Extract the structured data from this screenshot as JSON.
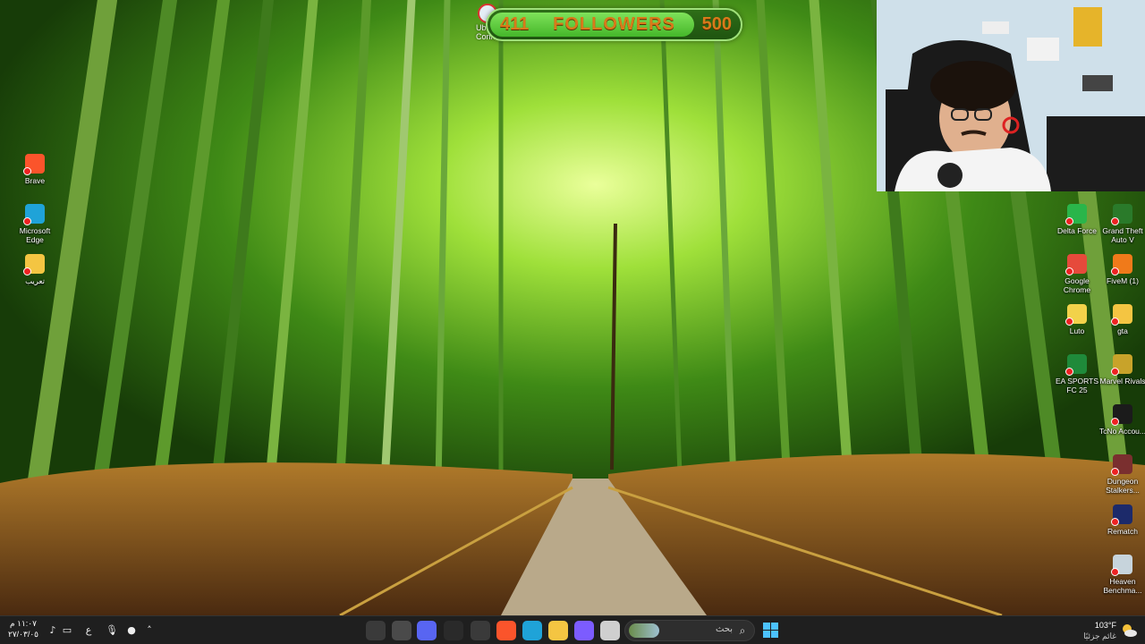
{
  "overlay": {
    "followers_current": "411",
    "followers_label": "FOLLOWERS",
    "followers_goal": "500",
    "progress_fraction": 0.822,
    "stream_icon_label": "Ub\nConn"
  },
  "desktop_left": [
    {
      "label": "Brave",
      "icon": "brave-icon",
      "color": "#fb542b"
    },
    {
      "label": "Microsoft Edge",
      "icon": "edge-icon",
      "color": "#1fa3d8"
    },
    {
      "label": "تعريب",
      "icon": "folder-icon",
      "color": "#f4c542"
    }
  ],
  "desktop_right": [
    {
      "label": "Delta Force",
      "icon": "delta-force-icon",
      "color": "#2ab54a"
    },
    {
      "label": "Grand Theft Auto V",
      "icon": "gta-v-icon",
      "color": "#2a7a2a"
    },
    {
      "label": "Google Chrome",
      "icon": "chrome-icon",
      "color": "#e64a3b"
    },
    {
      "label": "FiveM (1)",
      "icon": "fivem-icon",
      "color": "#f07a1a"
    },
    {
      "label": "Luto",
      "icon": "luto-icon",
      "color": "#f2d24a"
    },
    {
      "label": "gta",
      "icon": "folder-icon",
      "color": "#f4c542"
    },
    {
      "label": "EA SPORTS FC 25",
      "icon": "ea-fc-icon",
      "color": "#1f8a3a"
    },
    {
      "label": "Marvel Rivals",
      "icon": "marvel-rivals-icon",
      "color": "#c8a32a"
    },
    {
      "label": "TcNo Accou...",
      "icon": "tcno-icon",
      "color": "#1b1b1b"
    },
    {
      "label": "Dungeon Stalkers...",
      "icon": "dungeon-stalkers-icon",
      "color": "#7a2f2f"
    },
    {
      "label": "Rematch",
      "icon": "rematch-icon",
      "color": "#1c2a6a"
    },
    {
      "label": "Heaven Benchma...",
      "icon": "heaven-benchmark-icon",
      "color": "#c7d4dc"
    }
  ],
  "taskbar": {
    "clock_time": "١١:٠٧ م",
    "clock_date": "٢٧/٠٣/٠٥",
    "lang": "ع",
    "search_placeholder": "بحث",
    "weather_temp": "103°F",
    "weather_desc": "غائم جزئيًا",
    "apps": [
      {
        "icon": "obs-icon",
        "color": "#3a3a3a"
      },
      {
        "icon": "settings-icon",
        "color": "#4a4a4a"
      },
      {
        "icon": "discord-icon",
        "color": "#5865f2"
      },
      {
        "icon": "streamdeck-icon",
        "color": "#2a2a2a"
      },
      {
        "icon": "store-icon",
        "color": "#3a3a3a"
      },
      {
        "icon": "brave-icon",
        "color": "#fb542b"
      },
      {
        "icon": "edge-icon",
        "color": "#1fa3d8"
      },
      {
        "icon": "file-explorer-icon",
        "color": "#f4c542"
      },
      {
        "icon": "copilot-icon",
        "color": "#7c5cff"
      },
      {
        "icon": "task-view-icon",
        "color": "#cfcfcf"
      }
    ]
  }
}
